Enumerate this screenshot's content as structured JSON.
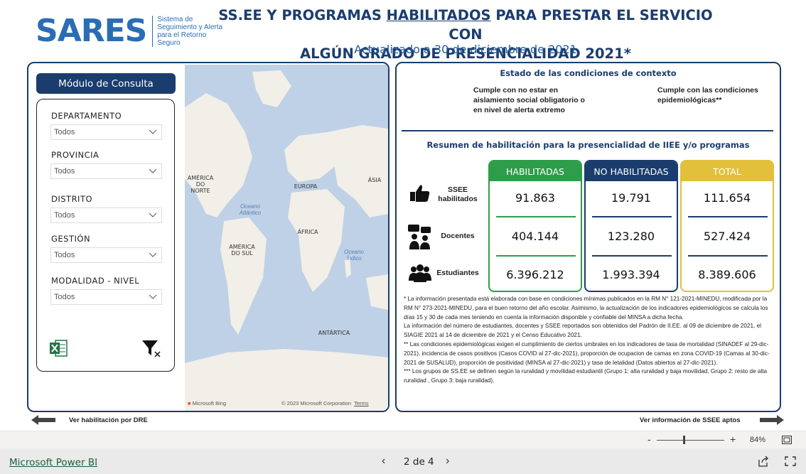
{
  "header": {
    "logo": "SARES",
    "logo_sub": "Sistema de Seguimiento y Alerta para el Retorno Seguro",
    "title_part1": "SS.EE Y PROGRAMAS ",
    "title_highlight": "HABILITADOS",
    "title_part2": " PARA PRESTAR EL SERVICIO CON",
    "title_line2": "ALGÚN GRADO DE PRESENCIALIDAD 2021*",
    "subtitle": "Actualizado a 30 de diciembre de 2021"
  },
  "filters": {
    "module_button": "Módulo de Consulta",
    "items": [
      {
        "label": "DEPARTAMENTO",
        "value": "Todos"
      },
      {
        "label": "PROVINCIA",
        "value": "Todos"
      },
      {
        "label": "DISTRITO",
        "value": "Todos"
      },
      {
        "label": "GESTIÓN",
        "value": "Todos"
      },
      {
        "label": "MODALIDAD - NIVEL",
        "value": "Todos"
      }
    ]
  },
  "map": {
    "labels": {
      "north_america": "AMÉRICA DO NORTE",
      "europe": "EUROPA",
      "asia": "ÁSIA",
      "atlantic": "Oceano Atlântico",
      "africa": "ÁFRICA",
      "south_america": "AMÉRICA DO SUL",
      "indian": "Oceano Índico",
      "antarctica": "ANTÁRTICA"
    },
    "provider": "Microsoft Bing",
    "copyright": "© 2023 Microsoft Corporation",
    "terms": "Terms"
  },
  "context": {
    "title": "Estado de las condiciones de contexto",
    "left": "Cumple con no estar en aislamiento social obligatorio o en nivel de alerta extremo",
    "right": "Cumple con las condiciones epidemiológicas**"
  },
  "summary": {
    "title": "Resumen de habilitación para la presencialidad de IIEE y/o programas",
    "rows": [
      "SSEE habilitados",
      "Docentes",
      "Estudiantes"
    ],
    "columns": [
      {
        "header": "HABILITADAS",
        "values": [
          "91.863",
          "404.144",
          "6.396.212"
        ]
      },
      {
        "header": "NO HABILITADAS",
        "values": [
          "19.791",
          "123.280",
          "1.993.394"
        ]
      },
      {
        "header": "TOTAL",
        "values": [
          "111.654",
          "527.424",
          "8.389.606"
        ]
      }
    ],
    "colors": {
      "green": "#2e9d4a",
      "navy": "#1a3d6e",
      "gold": "#e2c03a"
    }
  },
  "notes": {
    "n1": "* La información presentada está elaborada con base en condiciones mínimas publicados en la RM N° 121-2021-MINEDU, modificada por la RM N° 273-2021-MINEDU, para el buen retorno del año escolar. Asimismo, la actualización de los indicadores epidemiológicos se calcula los días 15 y 30 de cada mes teniendo en cuenta la información disponible y confiable del MINSA a dicha fecha.",
    "n2": "La información del número de estudiantes, docentes y SSEE reportados son obtenidos del Padrón de II.EE. al 09 de diciembre de 2021, el SIAGIE 2021 al 14 de diciembre de 2021 y el Censo Educativo 2021.",
    "n3": "** Las condiciones epidemiológicas exigen el cumplimiento de ciertos umbrales en los indicadores de tasa de mortalidad (SINADEF al 29-dic-2021), incidencia de casos positivos (Casos COVID al 27-dic-2021), proporción de ocupacion de camas en zona COVID-19 (Camas al 30-dic-2021 de SUSALUD), proporción de positividad (MINSA al 27-dic-2021) y tasa de letalidad (Datos abiertos al 27-dic-2021).",
    "n4": "*** Los grupos de SS.EE se definen según la ruralidad y movilidad estudiantil (Grupo 1: alta ruralidad y baja movilidad, Grupo 2: resto de alta ruralidad , Grupo 3: baja ruralidad)."
  },
  "nav": {
    "left": "Ver habilitación por DRE",
    "right": "Ver información de SSEE aptos"
  },
  "zoom": {
    "minus": "-",
    "plus": "+",
    "percent": "84%"
  },
  "footer": {
    "brand": "Microsoft Power BI",
    "pager": "2 de 4",
    "prev": "‹",
    "next": "›"
  }
}
